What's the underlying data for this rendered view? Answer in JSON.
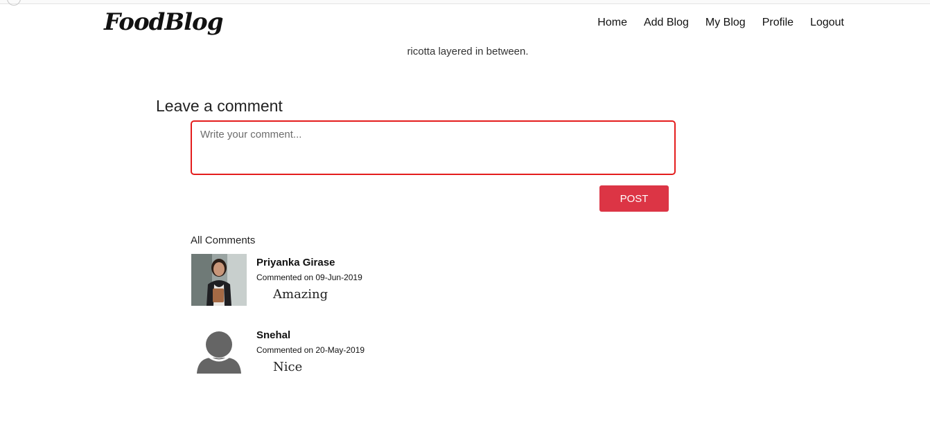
{
  "navbar": {
    "logo": "FoodBlog",
    "links": [
      {
        "label": "Home"
      },
      {
        "label": "Add Blog"
      },
      {
        "label": "My Blog"
      },
      {
        "label": "Profile"
      },
      {
        "label": "Logout"
      }
    ]
  },
  "article": {
    "partial_text": "ricotta layered in between."
  },
  "comment_form": {
    "title": "Leave a comment",
    "placeholder": "Write your comment...",
    "value": "",
    "post_label": "POST"
  },
  "comments_section": {
    "heading": "All Comments",
    "comments": [
      {
        "name": "Priyanka Girase",
        "date": "Commented on 09-Jun-2019",
        "text": "Amazing",
        "avatar": "user-photo"
      },
      {
        "name": "Snehal",
        "date": "Commented on 20-May-2019",
        "text": "Nice",
        "avatar": "default-user-icon"
      }
    ]
  },
  "colors": {
    "accent": "#dc3545",
    "input_border": "#e41c1c"
  }
}
